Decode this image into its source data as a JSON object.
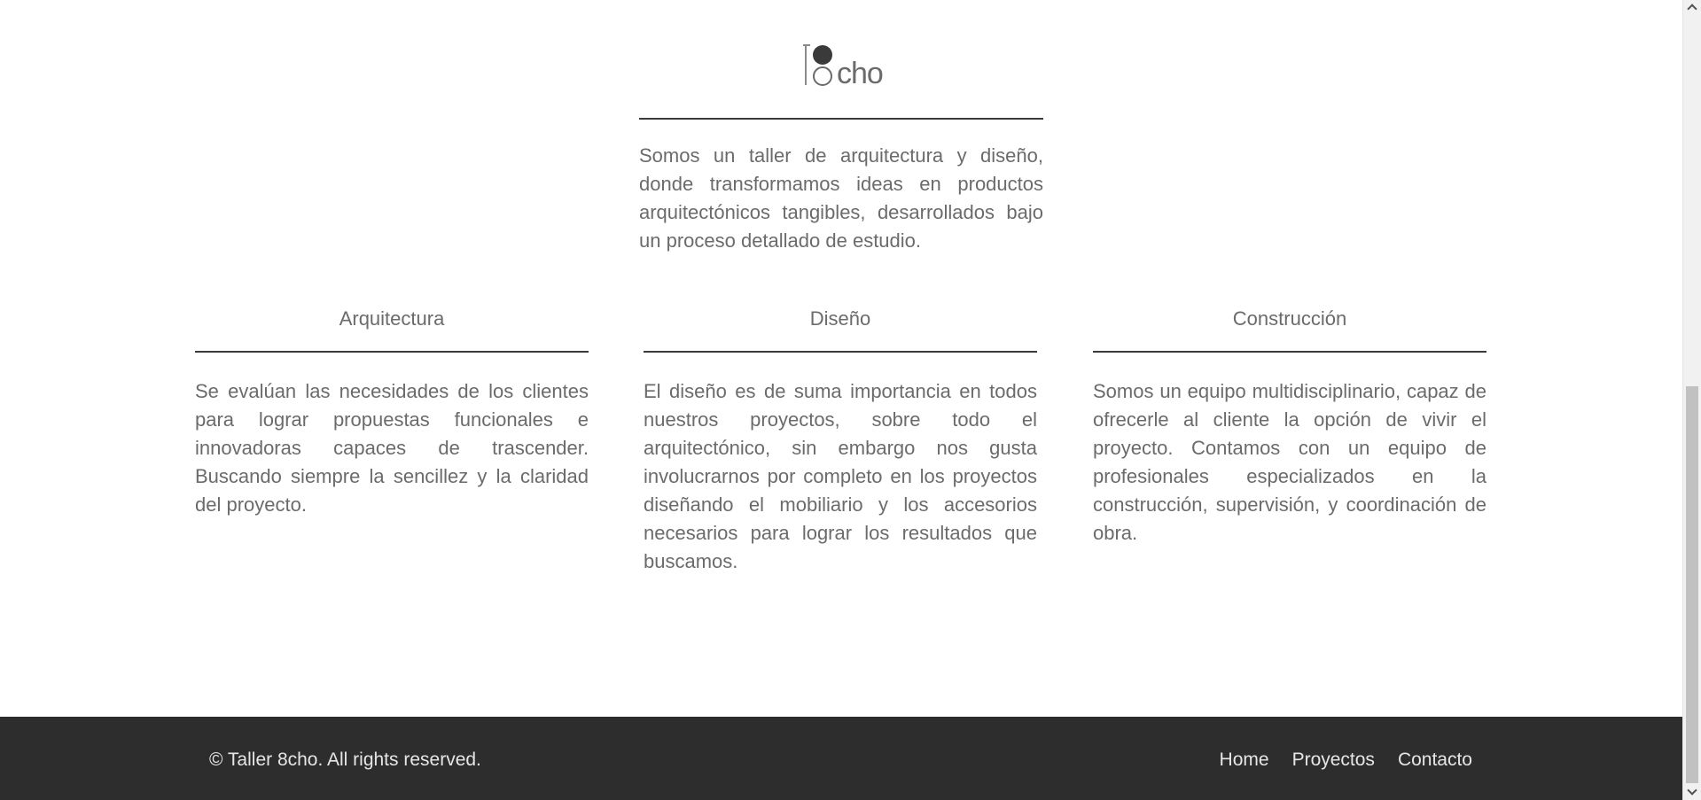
{
  "logo": {
    "word": "cho",
    "icon": "8cho-logo"
  },
  "intro": "Somos un taller de arquitectura y diseño, donde transformamos ideas en productos arquitectónicos tangibles, desarrollados bajo un proceso detallado de estudio.",
  "services": [
    {
      "title": "Arquitectura",
      "text": "Se evalúan las necesidades de los clientes para lograr propuestas funcionales e innovadoras capaces de trascender. Buscando siempre la sencillez y la claridad del proyecto."
    },
    {
      "title": "Diseño",
      "text": "El diseño es de suma importancia en todos nuestros proyectos, sobre todo el arquitectónico, sin embargo nos gusta involucrarnos por completo en los proyectos diseñando el mobiliario y los accesorios necesarios para lograr los resultados que buscamos."
    },
    {
      "title": "Construcción",
      "text": "Somos un equipo multidisciplinario, capaz de ofrecerle al cliente la opción de vivir el proyecto. Contamos con un equipo de profesionales especializados en la construcción, supervisión, y coordinación de obra."
    }
  ],
  "footer": {
    "copyright": "© Taller 8cho. All rights reserved.",
    "nav": [
      "Home",
      "Proyectos",
      "Contacto"
    ]
  },
  "colors": {
    "footer_bg": "#2d2d2d",
    "text": "#6b6b6b",
    "rule": "#3a3a3a"
  }
}
